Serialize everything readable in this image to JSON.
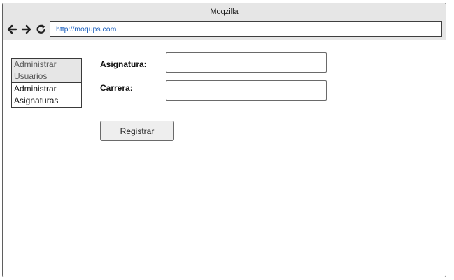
{
  "window": {
    "title": "Moqzilla"
  },
  "toolbar": {
    "back_icon": "arrow-left-icon",
    "forward_icon": "arrow-right-icon",
    "refresh_icon": "refresh-icon",
    "url": "http://moqups.com"
  },
  "sidebar": {
    "items": [
      {
        "label_line1": "Administrar",
        "label_line2": "Usuarios",
        "selected": true
      },
      {
        "label_line1": "Administrar",
        "label_line2": "Asignaturas",
        "selected": false
      }
    ]
  },
  "form": {
    "asignatura_label": "Asignatura:",
    "asignatura_value": "",
    "carrera_label": "Carrera:",
    "carrera_value": "",
    "submit_label": "Registrar"
  },
  "colors": {
    "chrome_background": "#e6e6e6",
    "url_text": "#1b5fbd",
    "border": "#3a3a3a"
  }
}
